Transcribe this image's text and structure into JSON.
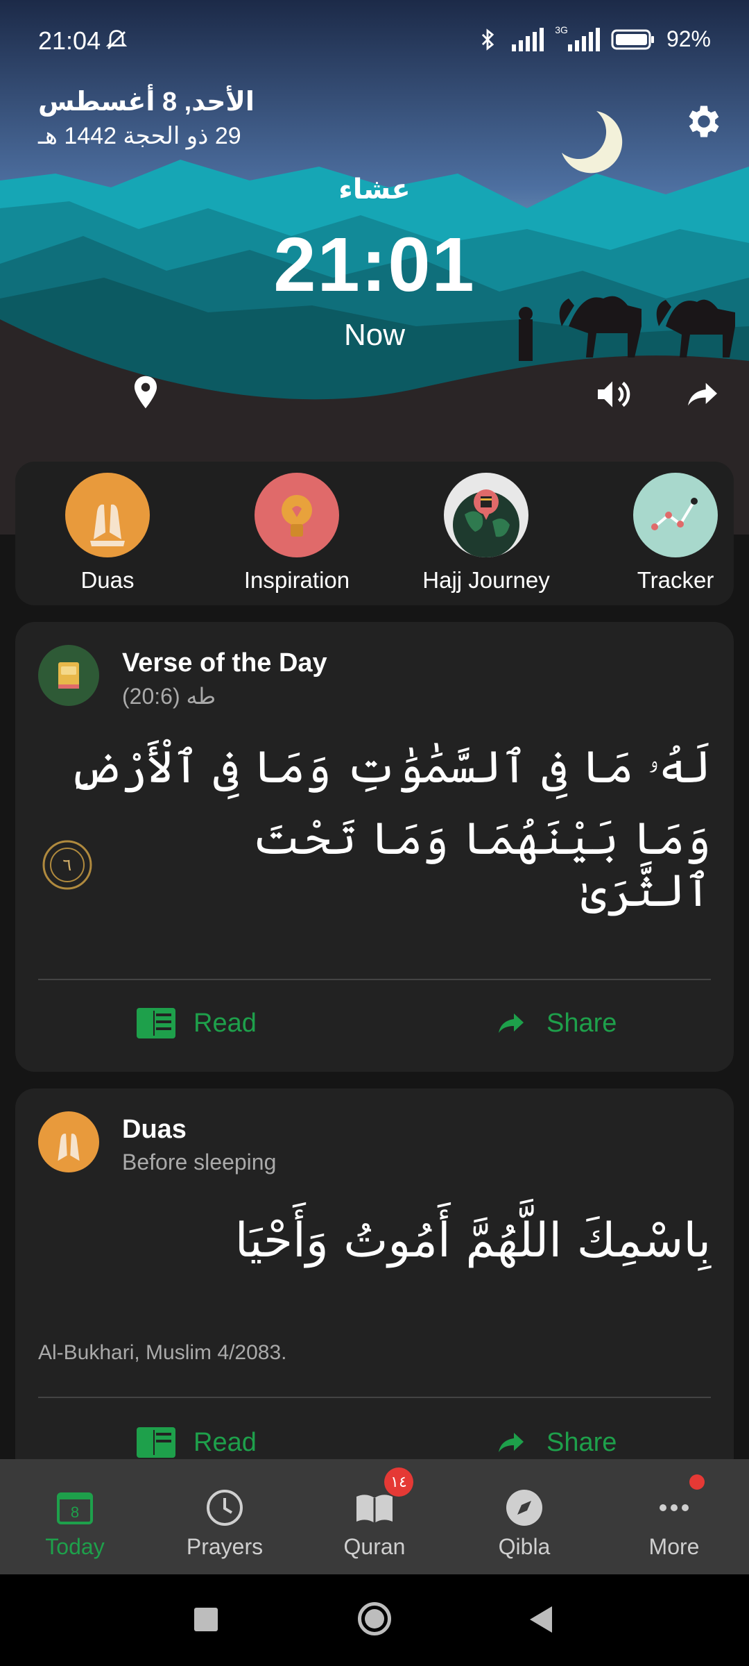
{
  "status_bar": {
    "time": "21:04",
    "network": "3G",
    "battery": "92%"
  },
  "header": {
    "gregorian_date": "الأحد, 8 أغسطس",
    "hijri_date": "29 ذو الحجة 1442 هـ",
    "prayer_name": "عشاء",
    "prayer_time": "21:01",
    "prayer_status": "Now",
    "icons": [
      "gear-icon",
      "location-pin-icon",
      "volume-icon",
      "share-icon"
    ]
  },
  "shortcuts": [
    {
      "label": "Duas",
      "icon": "praying-hands-icon",
      "color": "#e89a3c"
    },
    {
      "label": "Inspiration",
      "icon": "lightbulb-icon",
      "color": "#e06a6a"
    },
    {
      "label": "Hajj Journey",
      "icon": "globe-kaaba-icon",
      "color": "#e8e8e8"
    },
    {
      "label": "Tracker",
      "icon": "chart-icon",
      "color": "#a8d8cc"
    }
  ],
  "verse_card": {
    "title": "Verse of the Day",
    "subtitle": "طه (20:6)",
    "arabic_line1": "لَهُۥ مَا فِى ٱلسَّمَٰوَٰتِ وَمَا فِى ٱلْأَرْضِ",
    "arabic_line2": "وَمَا بَيْنَهُمَا وَمَا تَحْتَ ٱلثَّرَىٰ",
    "ayah_number": "٦",
    "read_label": "Read",
    "share_label": "Share"
  },
  "dua_card": {
    "title": "Duas",
    "subtitle": "Before sleeping",
    "arabic": "بِاسْمِكَ اللَّهُمَّ أَمُوتُ وَأَحْيَا",
    "reference": "Al-Bukhari, Muslim 4/2083.",
    "read_label": "Read",
    "share_label": "Share"
  },
  "bottom_nav": {
    "items": [
      {
        "label": "Today",
        "icon": "calendar-icon",
        "active": true,
        "day": "8"
      },
      {
        "label": "Prayers",
        "icon": "clock-icon",
        "active": false
      },
      {
        "label": "Quran",
        "icon": "book-icon",
        "active": false,
        "badge": "١٤"
      },
      {
        "label": "Qibla",
        "icon": "compass-icon",
        "active": false
      },
      {
        "label": "More",
        "icon": "more-icon",
        "active": false
      }
    ]
  },
  "colors": {
    "accent_green": "#1ea04b",
    "badge_red": "#e53935"
  }
}
